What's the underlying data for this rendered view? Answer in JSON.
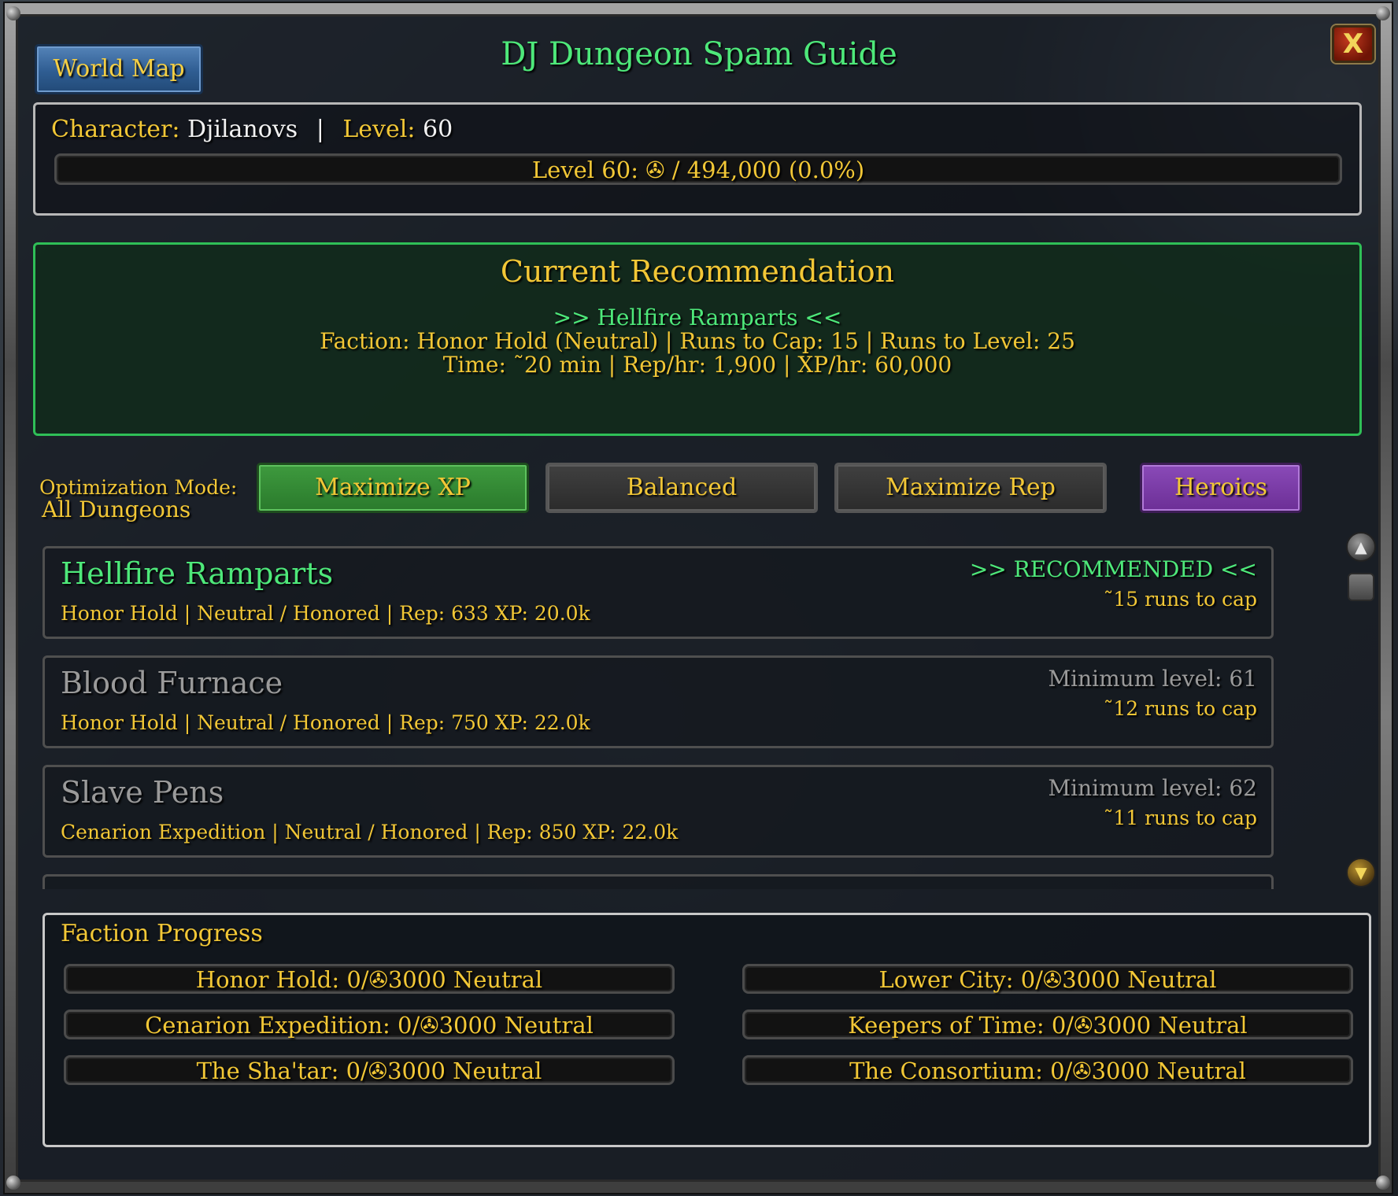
{
  "window": {
    "title": "DJ Dungeon Spam Guide",
    "world_map_label": "World Map",
    "close_label": "X"
  },
  "character": {
    "character_label": "Character:",
    "name": "Djilanovs",
    "separator": "|",
    "level_label": "Level:",
    "level": "60",
    "xp_bar_text": "Level 60: ✇ / 494,000 (0.0%)",
    "xp_fraction": 0.0
  },
  "recommendation": {
    "heading": "Current Recommendation",
    "dungeon_line": ">> Hellfire Ramparts <<",
    "faction_line": "Faction: Honor Hold (Neutral) | Runs to Cap: 15 | Runs to Level: 25",
    "time_line": "Time: ˜20 min | Rep/hr: 1,900 | XP/hr: 60,000"
  },
  "optimization": {
    "label": "Optimization Mode:",
    "value": "All Dungeons",
    "buttons": [
      {
        "label": "Maximize XP",
        "state": "active"
      },
      {
        "label": "Balanced",
        "state": "normal"
      },
      {
        "label": "Maximize Rep",
        "state": "normal"
      },
      {
        "label": "Heroics",
        "state": "heroic"
      }
    ]
  },
  "dungeons": [
    {
      "name": "Hellfire Ramparts",
      "info": "Honor Hold  |  Neutral / Honored  |  Rep: 633   XP: 20.0k",
      "status": ">> RECOMMENDED <<",
      "runs": "˜15 runs to cap",
      "available": true
    },
    {
      "name": "Blood Furnace",
      "info": "Honor Hold  |  Neutral / Honored  |  Rep: 750   XP: 22.0k",
      "status": "Minimum level: 61",
      "runs": "˜12 runs to cap",
      "available": false
    },
    {
      "name": "Slave Pens",
      "info": "Cenarion Expedition  |  Neutral / Honored  |  Rep: 850   XP: 22.0k",
      "status": "Minimum level: 62",
      "runs": "˜11 runs to cap",
      "available": false
    }
  ],
  "factions": {
    "title": "Faction Progress",
    "bars": [
      {
        "text": "Honor Hold: 0/✇3000 Neutral",
        "fraction": 0.0
      },
      {
        "text": "Lower City: 0/✇3000 Neutral",
        "fraction": 0.0
      },
      {
        "text": "Cenarion Expedition: 0/✇3000 Neutral",
        "fraction": 0.0
      },
      {
        "text": "Keepers of Time: 0/✇3000 Neutral",
        "fraction": 0.0
      },
      {
        "text": "The Sha'tar: 0/✇3000 Neutral",
        "fraction": 0.0
      },
      {
        "text": "The Consortium: 0/✇3000 Neutral",
        "fraction": 0.0
      }
    ]
  },
  "colors": {
    "title_green": "#4ee87a",
    "gold_text": "#f2c736",
    "recommended_green": "#4ee87a",
    "unavailable_gray": "#9a9a9a",
    "active_mode": "#3e9a3e",
    "heroic_mode": "#8a4ab8",
    "world_map_blue": "#2f5d92"
  }
}
